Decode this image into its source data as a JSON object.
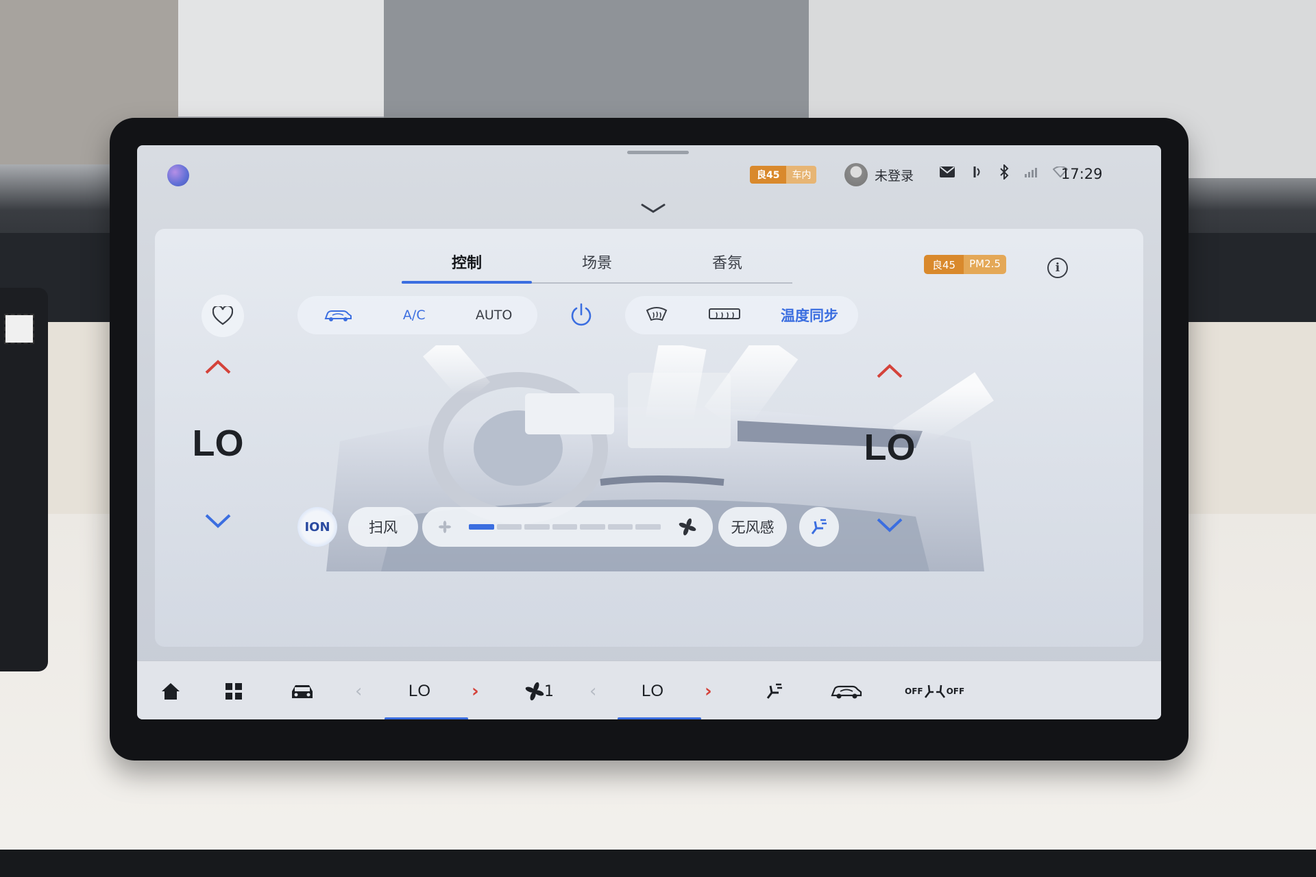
{
  "status_bar": {
    "air_quality_value": "良45",
    "air_quality_location": "车内",
    "login_status": "未登录",
    "time": "17:29",
    "icons": [
      "assistant-orb-icon",
      "avatar-icon",
      "mail-icon",
      "audio-icon",
      "bluetooth-icon",
      "signal-icon",
      "wifi-icon"
    ]
  },
  "tabs": [
    {
      "label": "控制",
      "active": true
    },
    {
      "label": "场景",
      "active": false
    },
    {
      "label": "香氛",
      "active": false
    }
  ],
  "pm_badge": {
    "value": "良45",
    "label": "PM2.5"
  },
  "mode_group": {
    "circulation_icon": "car-recirculation-icon",
    "ac_label": "A/C",
    "auto_label": "AUTO"
  },
  "right_group": {
    "front_defrost_icon": "front-defrost-icon",
    "rear_defrost_icon": "rear-defrost-icon",
    "sync_label": "温度同步"
  },
  "left_zone": {
    "temperature": "LO"
  },
  "right_zone": {
    "temperature": "LO"
  },
  "bottom_controls": {
    "ion_label": "ION",
    "sweep_label": "扫风",
    "fan_level": 1,
    "fan_max": 7,
    "no_wind_label": "无风感"
  },
  "dock": {
    "left_temp": "LO",
    "right_temp": "LO",
    "fan_level_label": "1",
    "seat_off_left": "OFF",
    "seat_off_right": "OFF"
  },
  "colors": {
    "accent": "#3b6ee0",
    "up_arrow": "#d4423a",
    "down_arrow": "#3b6ee0",
    "badge": "#d9892c"
  }
}
